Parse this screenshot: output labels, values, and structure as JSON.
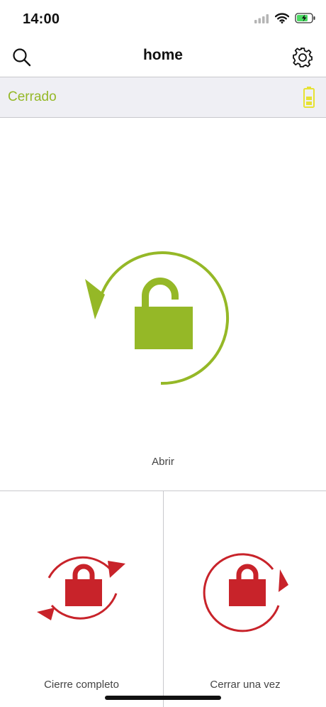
{
  "status_bar": {
    "time": "14:00",
    "icons": [
      "cellular-signal-icon",
      "wifi-icon",
      "battery-charging-icon"
    ]
  },
  "nav": {
    "title": "home",
    "left_icon": "search-icon",
    "right_icon": "gear-icon"
  },
  "lock_status": {
    "label": "Cerrado",
    "color": "#95b827",
    "battery_icon": "battery-icon",
    "battery_color": "#e6e234"
  },
  "actions": {
    "open": {
      "label": "Abrir",
      "icon": "unlock-rotate-icon",
      "color": "#95b827"
    },
    "full_lock": {
      "label": "Cierre completo",
      "icon": "lock-double-rotate-icon",
      "color": "#c8232a"
    },
    "lock_once": {
      "label": "Cerrar una vez",
      "icon": "lock-rotate-icon",
      "color": "#c8232a"
    }
  }
}
